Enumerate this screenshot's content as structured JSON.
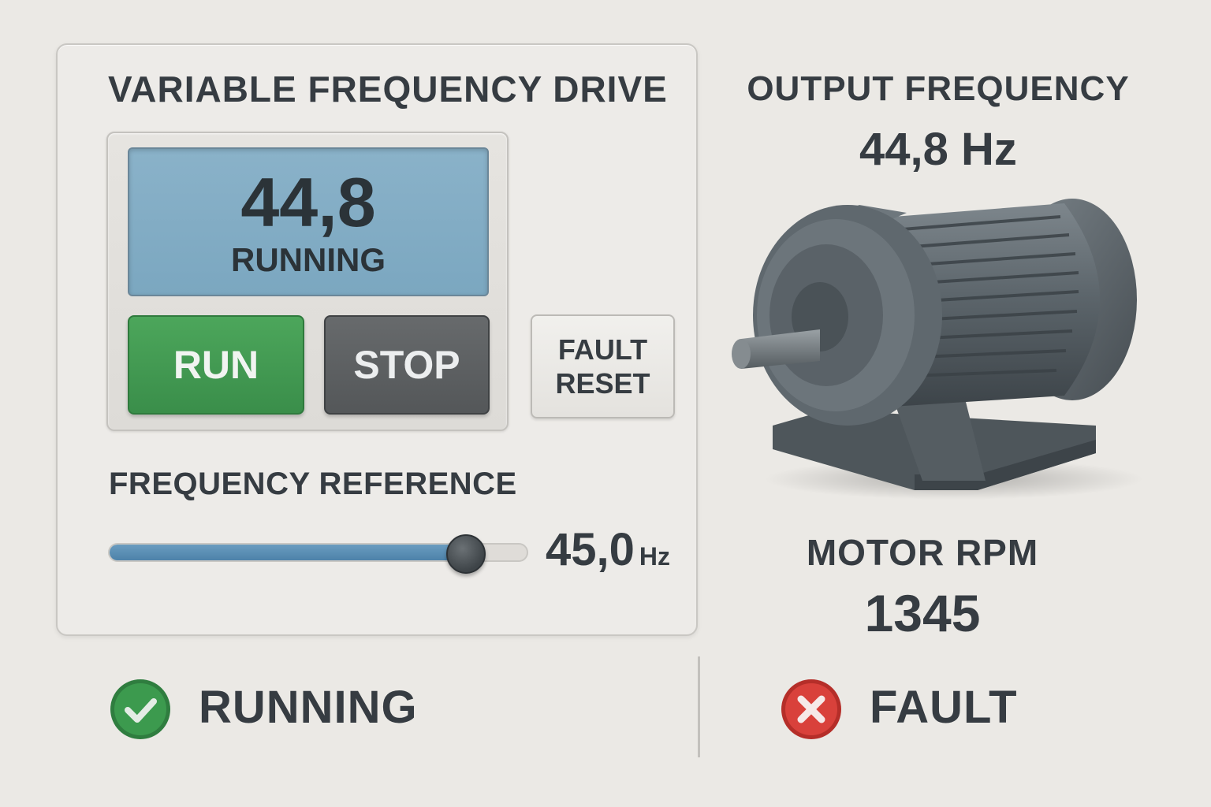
{
  "drive": {
    "title": "VARIABLE FREQUENCY DRIVE",
    "display": {
      "value": "44,8",
      "status": "RUNNING"
    },
    "buttons": {
      "run": "RUN",
      "stop": "STOP",
      "reset_line1": "FAULT",
      "reset_line2": "RESET"
    },
    "frequency_reference": {
      "label": "FREQUENCY REFERENCE",
      "value": "45,0",
      "unit": "Hz",
      "slider_fraction": 0.84
    }
  },
  "output": {
    "frequency_label": "OUTPUT FREQUENCY",
    "frequency_value": "44,8 Hz",
    "rpm_label": "MOTOR RPM",
    "rpm_value": "1345"
  },
  "status_bar": {
    "running": {
      "label": "RUNNING",
      "icon": "check-circle-icon",
      "color": "#3a9a4d"
    },
    "fault": {
      "label": "FAULT",
      "icon": "x-circle-icon",
      "color": "#d9403a"
    }
  },
  "colors": {
    "run_button": "#3f9a4f",
    "stop_button": "#5a5d5f",
    "lcd": "#82adc5",
    "slider_fill": "#5a8db3"
  }
}
